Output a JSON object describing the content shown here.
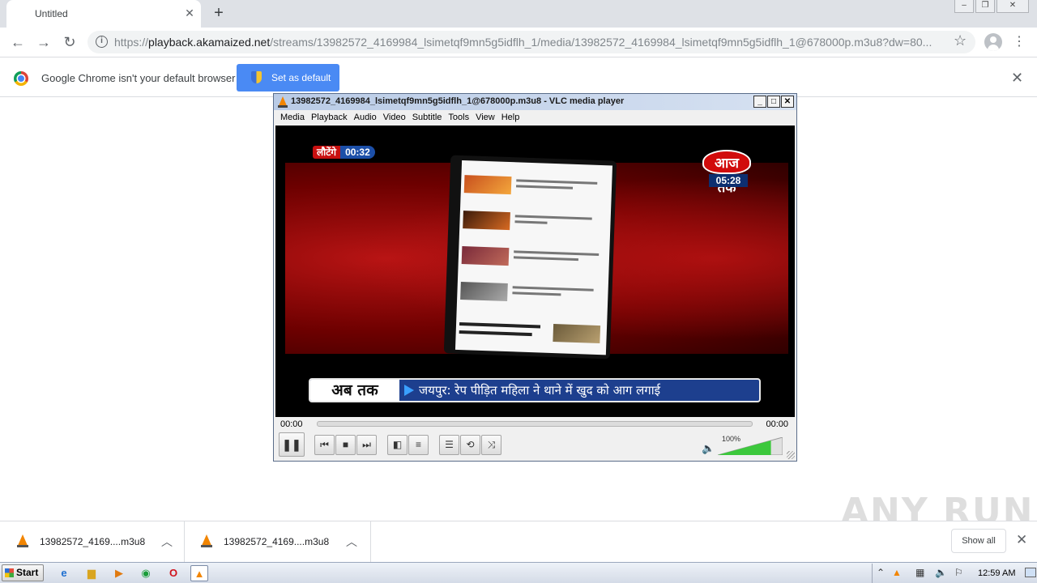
{
  "browser": {
    "tab_title": "Untitled",
    "url_prefix": "https://",
    "url_host": "playback.akamaized.net",
    "url_path": "/streams/13982572_4169984_lsimetqf9mn5g5idflh_1/media/13982572_4169984_lsimetqf9mn5g5idflh_1@678000p.m3u8?dw=80...",
    "infobar_text": "Google Chrome isn't your default browser",
    "set_default_label": "Set as default",
    "accent": "#4a8af4"
  },
  "vlc": {
    "title": "13982572_4169984_lsimetqf9mn5g5idflh_1@678000p.m3u8 - VLC media player",
    "menu": [
      "Media",
      "Playback",
      "Audio",
      "Video",
      "Subtitle",
      "Tools",
      "View",
      "Help"
    ],
    "time_elapsed": "00:00",
    "time_total": "00:00",
    "volume": "100%",
    "volume_level": 1.0,
    "video": {
      "countdown_label": "लौटेंगे",
      "countdown_time": "00:32",
      "channel_logo": "आज तक",
      "channel_clock": "05:28",
      "ticker_label": "अब तक",
      "ticker_text": "जयपुर: रेप पीड़ित महिला ने थाने में खुद को आग लगाई"
    }
  },
  "downloads": {
    "items": [
      {
        "name": "13982572_4169....m3u8"
      },
      {
        "name": "13982572_4169....m3u8"
      }
    ],
    "show_all_label": "Show all"
  },
  "watermark": "ANY RUN",
  "taskbar": {
    "start_label": "Start",
    "clock": "12:59 AM"
  }
}
